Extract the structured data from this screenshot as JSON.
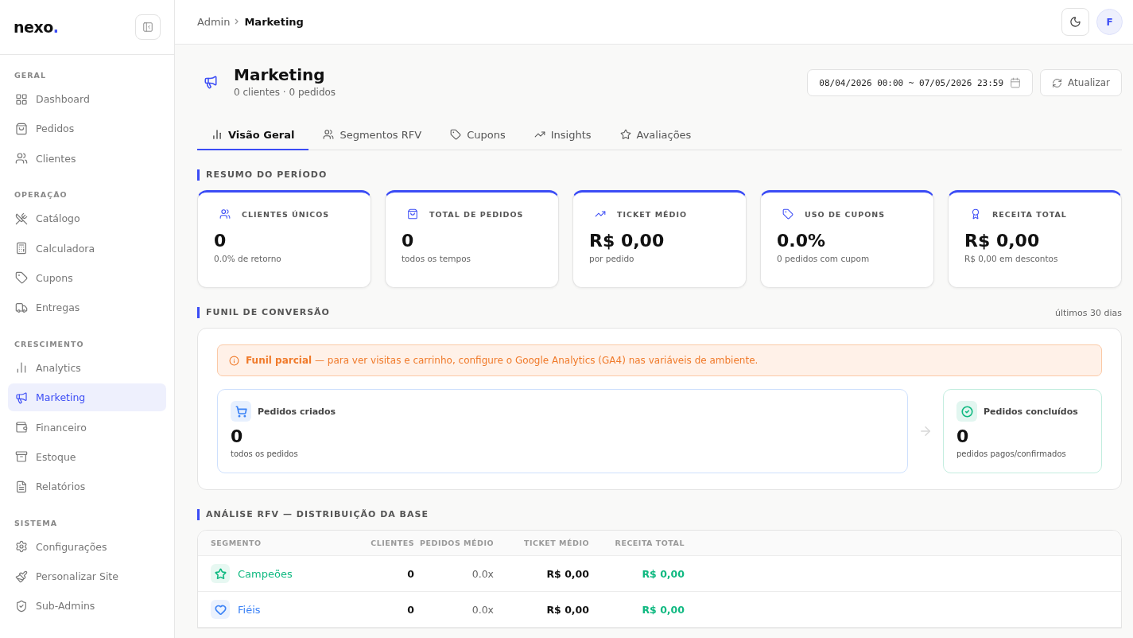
{
  "sidebar": {
    "logo": {
      "text": "nexo",
      "dot": "."
    },
    "sections": [
      {
        "title": "GERAL",
        "items": [
          {
            "label": "Dashboard",
            "selected": false
          },
          {
            "label": "Pedidos",
            "selected": false
          },
          {
            "label": "Clientes",
            "selected": false
          }
        ]
      },
      {
        "title": "OPERAÇÃO",
        "items": [
          {
            "label": "Catálogo",
            "selected": false
          },
          {
            "label": "Calculadora",
            "selected": false
          },
          {
            "label": "Cupons",
            "selected": false
          },
          {
            "label": "Entregas",
            "selected": false
          }
        ]
      },
      {
        "title": "CRESCIMENTO",
        "items": [
          {
            "label": "Analytics",
            "selected": false
          },
          {
            "label": "Marketing",
            "selected": true
          },
          {
            "label": "Financeiro",
            "selected": false
          },
          {
            "label": "Estoque",
            "selected": false
          },
          {
            "label": "Relatórios",
            "selected": false
          }
        ]
      },
      {
        "title": "SISTEMA",
        "items": [
          {
            "label": "Configurações",
            "selected": false
          },
          {
            "label": "Personalizar Site",
            "selected": false
          },
          {
            "label": "Sub-Admins",
            "selected": false
          }
        ]
      }
    ]
  },
  "breadcrumb": [
    "Admin",
    "Marketing"
  ],
  "avatar": "F",
  "page": {
    "title": "Marketing",
    "subtitle": "0 clientes · 0 pedidos",
    "date_range": "08/04/2026 00:00 ~ 07/05/2026 23:59",
    "refresh_button": "Atualizar"
  },
  "tabs": [
    {
      "label": "Visão Geral",
      "selected": true
    },
    {
      "label": "Segmentos RFV",
      "selected": false
    },
    {
      "label": "Cupons",
      "selected": false
    },
    {
      "label": "Insights",
      "selected": false
    },
    {
      "label": "Avaliações",
      "selected": false
    }
  ],
  "summary": {
    "title": "RESUMO DO PERÍODO",
    "cards": [
      {
        "label": "CLIENTES ÚNICOS",
        "value": "0",
        "note": "0.0% de retorno"
      },
      {
        "label": "TOTAL DE PEDIDOS",
        "value": "0",
        "note": "todos os tempos"
      },
      {
        "label": "TICKET MÉDIO",
        "value": "R$ 0,00",
        "note": "por pedido"
      },
      {
        "label": "USO DE CUPONS",
        "value": "0.0%",
        "note": "0 pedidos com cupom"
      },
      {
        "label": "RECEITA TOTAL",
        "value": "R$ 0,00",
        "note": "R$ 0,00 em descontos"
      }
    ]
  },
  "funnel": {
    "title": "FUNIL DE CONVERSÃO",
    "period": "últimos 30 dias",
    "alert": "**Funil parcial** — para ver visitas e carrinho, configure o Google Analytics (GA4) nas variáveis de ambiente.",
    "steps": [
      {
        "label": "Pedidos criados",
        "color": "#3b82f6",
        "value": "0",
        "note": "todos os pedidos"
      },
      {
        "label": "Pedidos concluídos",
        "color": "#10b981",
        "value": "0",
        "note": "pedidos pagos/confirmados"
      }
    ]
  },
  "rfv": {
    "title": "ANÁLISE RFV — DISTRIBUIÇÃO DA BASE",
    "columns": [
      "SEGMENTO",
      "CLIENTES",
      "PEDIDOS MÉDIO",
      "TICKET MÉDIO",
      "RECEITA TOTAL"
    ],
    "rows": [
      {
        "segment": "Campeões",
        "color": "#10b981",
        "clients": "0",
        "orders": "0.0x",
        "ticket": "R$ 0,00",
        "revenue": "R$ 0,00"
      },
      {
        "segment": "Fiéis",
        "color": "#3b82f6",
        "clients": "0",
        "orders": "0.0x",
        "ticket": "R$ 0,00",
        "revenue": "R$ 0,00"
      }
    ]
  }
}
